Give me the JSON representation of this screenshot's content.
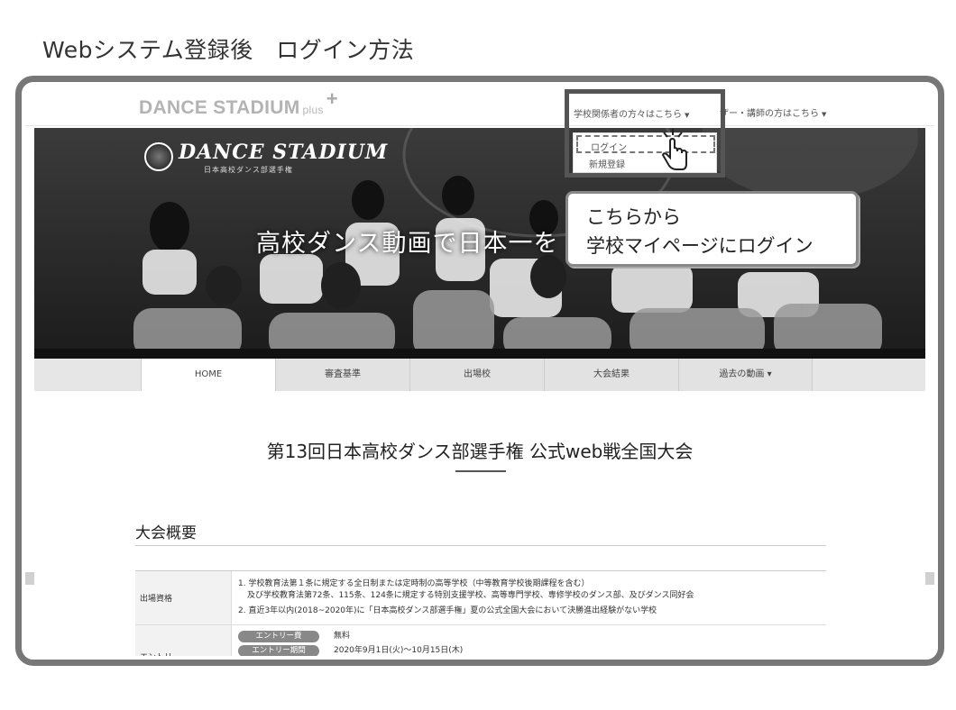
{
  "heading": "Webシステム登録後　ログイン方法",
  "site": {
    "logo_main": "DANCE STADIUM",
    "logo_plus": "plus",
    "logo_plus_sign": "+",
    "nav_school": "学校関係者の方々はこちら",
    "nav_other": "ザー・講師の方はこちら",
    "caret": "▼"
  },
  "dropdown": {
    "login": "ログイン",
    "register": "新規登録"
  },
  "hero": {
    "logo_text": "DANCE STADIUM",
    "logo_sub": "日本高校ダンス部選手権",
    "title": "高校ダンス動画で日本一を"
  },
  "callout": {
    "line1": "こちらから",
    "line2": "学校マイページにログイン"
  },
  "nav": {
    "items": [
      {
        "label": "HOME"
      },
      {
        "label": "審査基準"
      },
      {
        "label": "出場校"
      },
      {
        "label": "大会結果"
      },
      {
        "label": "過去の動画 ▾"
      }
    ]
  },
  "content": {
    "title": "第13回日本高校ダンス部選手権 公式web戦全国大会",
    "section": "大会概要",
    "rows": [
      {
        "label": "出場資格",
        "line1": "1. 学校教育法第１条に規定する全日制または定時制の高等学校（中等教育学校後期課程を含む）",
        "line2": "及び学校教育法第72条、115条、124条に規定する特別支援学校、高等専門学校、専修学校のダンス部、及びダンス同好会",
        "line3": "2. 直近3年以内(2018~2020年)に「日本高校ダンス部選手権」夏の公式全国大会において決勝進出経験がない学校"
      },
      {
        "label": "エントリー",
        "badge1": "エントリー費",
        "value1": "無料",
        "badge2": "エントリー期間",
        "value2": "2020年9月1日(火)〜10月15日(木)"
      }
    ]
  }
}
